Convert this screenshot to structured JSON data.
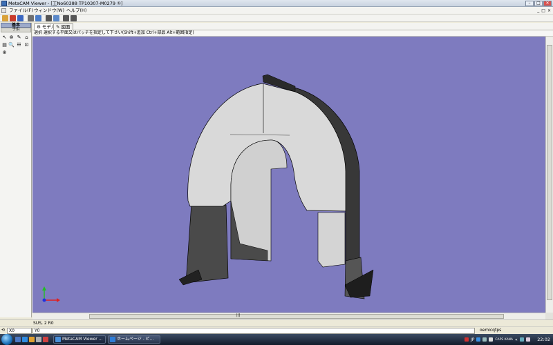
{
  "window": {
    "title": "MetaCAM Viewer - [工No60388 TP10307-M0279 ①]",
    "controls": [
      "–",
      "□",
      "✕"
    ]
  },
  "menu": {
    "items": [
      "ファイル(F)",
      "ウィンドウ(W)",
      "ヘルプ(H)"
    ],
    "mdi_controls": [
      "_",
      "□",
      "×"
    ]
  },
  "toolbar": {
    "buttons": [
      {
        "icon": "open-folder-icon",
        "color": "#d9a23a"
      },
      {
        "icon": "open-red-icon",
        "color": "#c83c2c"
      },
      {
        "icon": "open-blue-icon",
        "color": "#3a66c0"
      },
      {
        "icon": "print-icon",
        "color": "#6f6f6f"
      },
      {
        "icon": "page-icon",
        "color": "#4a7cc8"
      },
      {
        "icon": "cut-icon",
        "color": "#555555"
      },
      {
        "icon": "copy-icon",
        "color": "#5b89c9"
      },
      {
        "icon": "query-icon",
        "color": "#555555"
      },
      {
        "icon": "select-icon",
        "color": "#555555"
      }
    ]
  },
  "left_panel": {
    "header": "基本",
    "sub": "子供",
    "tools": [
      "↖",
      "⊗",
      "✎",
      "⌂",
      "▤",
      "🔍",
      "☷",
      "⊡",
      "⊕"
    ]
  },
  "tabs": [
    {
      "icon": "gear-icon",
      "label": "モデル",
      "active": true
    },
    {
      "icon": "pencil-icon",
      "label": "図面",
      "active": false
    }
  ],
  "hint": "選択  選択する平面又はパッチを指定して下さい(Shift+追加 Ctrl+部品 Alt+範囲指定)",
  "viewport": {
    "background": "#7e7bbf",
    "model": "sheet-metal-arch-bracket",
    "axes": {
      "x_color": "#e02020",
      "y_color": "#20c020",
      "z_color": "#2030e0"
    }
  },
  "status": {
    "material": "SUS, 2 R0"
  },
  "coords": {
    "x": "X0",
    "y": "Y0",
    "user": "oemicqtps"
  },
  "taskbar": {
    "start": "start-orb",
    "tasks": [
      {
        "label": "MetaCAM Viewer ...",
        "active": true,
        "color": "#4a90d9"
      },
      {
        "label": "ホームページ - ビ...",
        "active": false,
        "color": "#2f7dd6"
      }
    ],
    "tray_lang": "JP",
    "tray_note": "CAPS KANA",
    "clock": "22:02"
  }
}
